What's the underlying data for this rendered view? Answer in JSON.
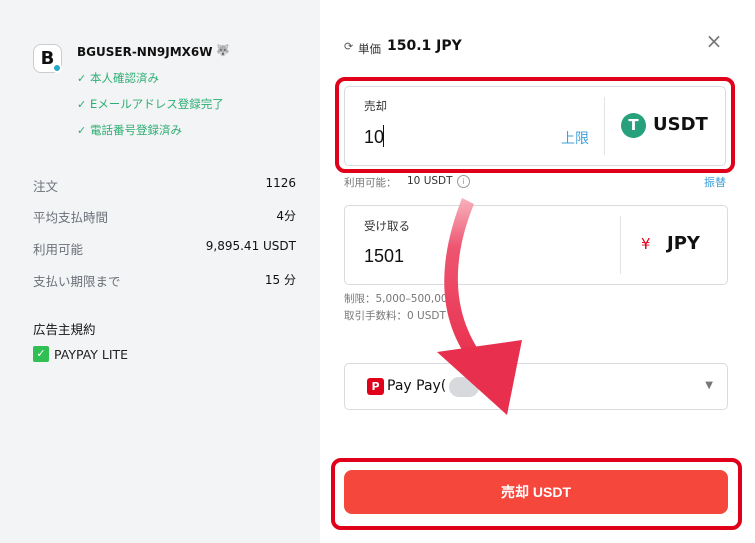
{
  "user": {
    "avatar_letter": "B",
    "username": "BGUSER-NN9JMX6W",
    "tag_icon": "fox-icon",
    "tag_glyph": "🐺",
    "verifications": [
      "本人確認済み",
      "Eメールアドレス登録完了",
      "電話番号登録済み"
    ]
  },
  "stats": [
    {
      "label": "注文",
      "value": "1126"
    },
    {
      "label": "平均支払時間",
      "value": "4分"
    },
    {
      "label": "利用可能",
      "value": "9,895.41 USDT"
    },
    {
      "label": "支払い期限まで",
      "value": "15 分"
    }
  ],
  "terms": {
    "title": "広告主規約",
    "payment_method": "PAYPAY LITE",
    "icon_glyph": "✓"
  },
  "rate": {
    "icon": "refresh-icon",
    "icon_glyph": "⟳",
    "label": "単価",
    "value": "150.1 JPY"
  },
  "close_glyph": "×",
  "sell": {
    "label": "売却",
    "value": "10",
    "max_label": "上限",
    "currency": "USDT",
    "currency_glyph": "T"
  },
  "available": {
    "label": "利用可能：",
    "value": "10 USDT",
    "info_glyph": "i",
    "transfer_label": "振替"
  },
  "receive": {
    "label": "受け取る",
    "value": "1501",
    "currency": "JPY",
    "currency_glyph": "¥"
  },
  "limits": {
    "limit_text": "制限：5,000–500,000",
    "fee_text": "取引手数料：0 USDT"
  },
  "payment_select": {
    "logo_glyph": "P",
    "value": "Pay Pay(",
    "caret_glyph": "▼"
  },
  "submit": {
    "label": "売却 USDT"
  },
  "colors": {
    "accent_red": "#f5473c",
    "annotation_red": "#e0001a",
    "verified_green": "#2dae72",
    "link_blue": "#3ea0d8",
    "tether_green": "#26a17b"
  }
}
